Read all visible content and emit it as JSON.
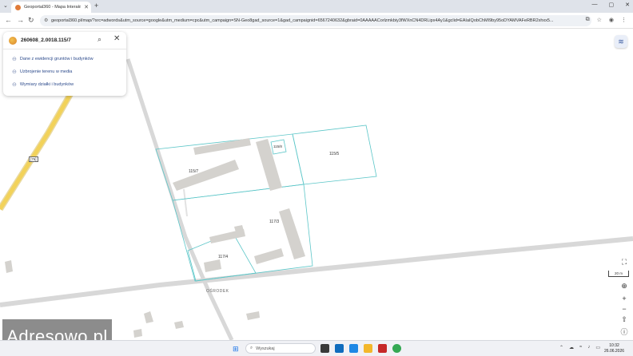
{
  "browser": {
    "tab_title": "Geoportal360 - Mapa Interakt...",
    "tab_close": "✕",
    "new_tab": "+",
    "url": "geoportal360.pl/map/?src=adwords&utm_source=google&utm_medium=cpc&utm_campaign=SN-Geo8gad_source=1&gad_campaignid=6567240632&gbraid=0AAAAACorlzmkbiy3fWXnCN4DRLipx4Ay1&gclid=EAIaIQobChMI9by95oDYAMVAFeRBR2xhxx5...",
    "window_buttons": [
      "—",
      "▢",
      "✕"
    ]
  },
  "panel": {
    "search_value": "260608_2.0018.115/7",
    "items": [
      {
        "label": "Dane z ewidencji gruntów i budynków"
      },
      {
        "label": "Uzbrojenie terenu w media"
      },
      {
        "label": "Wymiary działki i budynków"
      }
    ]
  },
  "map": {
    "parcel_labels": [
      "115/7",
      "115/8",
      "115/5",
      "117/3",
      "117/4"
    ],
    "street_name": "OŚRODEK",
    "road_number": "[76]",
    "scale_label": "20 m"
  },
  "watermark": "Adresowo.pl",
  "taskbar": {
    "search_placeholder": "Wyszukaj",
    "time": "10:32",
    "date": "26.06.2026"
  },
  "colors": {
    "parcel_line": "#5cc6c8",
    "building_fill": "#d4d2ce",
    "road_yellow": "#f2d25a",
    "link_text": "#2d4b8c"
  }
}
